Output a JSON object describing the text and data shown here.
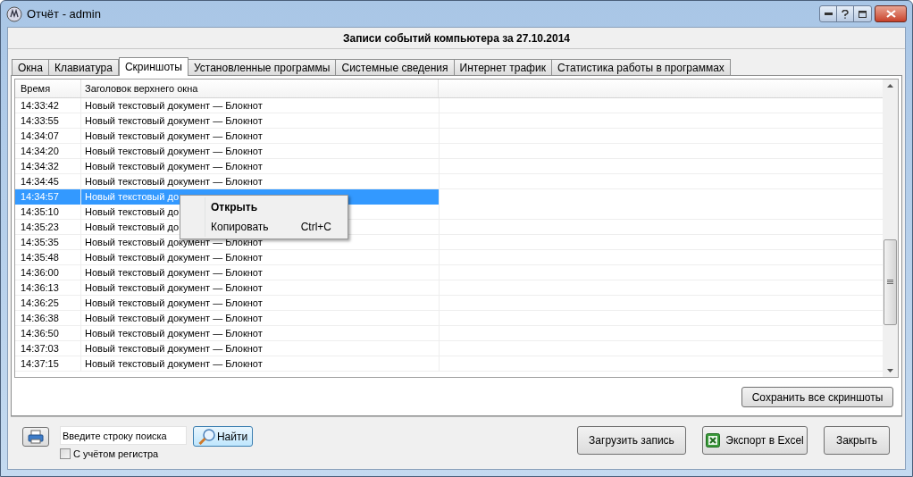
{
  "window": {
    "title": "Отчёт - admin"
  },
  "header": "Записи событий компьютера за 27.10.2014",
  "tabs": [
    {
      "label": "Окна",
      "selected": false
    },
    {
      "label": "Клавиатура",
      "selected": false
    },
    {
      "label": "Скриншоты",
      "selected": true
    },
    {
      "label": "Установленные программы",
      "selected": false
    },
    {
      "label": "Системные сведения",
      "selected": false
    },
    {
      "label": "Интернет трафик",
      "selected": false
    },
    {
      "label": "Статистика работы в программах",
      "selected": false
    }
  ],
  "table": {
    "columns": [
      "Время",
      "Заголовок верхнего окна"
    ],
    "rows": [
      {
        "time": "14:33:42",
        "title": "Новый текстовый документ — Блокнот",
        "selected": false
      },
      {
        "time": "14:33:55",
        "title": "Новый текстовый документ — Блокнот",
        "selected": false
      },
      {
        "time": "14:34:07",
        "title": "Новый текстовый документ — Блокнот",
        "selected": false
      },
      {
        "time": "14:34:20",
        "title": "Новый текстовый документ — Блокнот",
        "selected": false
      },
      {
        "time": "14:34:32",
        "title": "Новый текстовый документ — Блокнот",
        "selected": false
      },
      {
        "time": "14:34:45",
        "title": "Новый текстовый документ — Блокнот",
        "selected": false
      },
      {
        "time": "14:34:57",
        "title": "Новый текстовый до",
        "selected": true
      },
      {
        "time": "14:35:10",
        "title": "Новый текстовый до",
        "selected": false
      },
      {
        "time": "14:35:23",
        "title": "Новый текстовый до",
        "selected": false
      },
      {
        "time": "14:35:35",
        "title": "Новый текстовый документ — Блокнот",
        "selected": false
      },
      {
        "time": "14:35:48",
        "title": "Новый текстовый документ — Блокнот",
        "selected": false
      },
      {
        "time": "14:36:00",
        "title": "Новый текстовый документ — Блокнот",
        "selected": false
      },
      {
        "time": "14:36:13",
        "title": "Новый текстовый документ — Блокнот",
        "selected": false
      },
      {
        "time": "14:36:25",
        "title": "Новый текстовый документ — Блокнот",
        "selected": false
      },
      {
        "time": "14:36:38",
        "title": "Новый текстовый документ — Блокнот",
        "selected": false
      },
      {
        "time": "14:36:50",
        "title": "Новый текстовый документ — Блокнот",
        "selected": false
      },
      {
        "time": "14:37:03",
        "title": "Новый текстовый документ — Блокнот",
        "selected": false
      },
      {
        "time": "14:37:15",
        "title": "Новый текстовый документ — Блокнот",
        "selected": false
      }
    ]
  },
  "context_menu": {
    "items": [
      {
        "label": "Открыть",
        "bold": true
      },
      {
        "label": "Копировать",
        "shortcut": "Ctrl+C",
        "bold": false
      }
    ]
  },
  "save_all_button": "Сохранить все скриншоты",
  "search": {
    "placeholder": "Введите строку поиска",
    "button": "Найти",
    "case_checkbox": {
      "label": "С учётом регистра",
      "checked": false
    }
  },
  "buttons": {
    "load": "Загрузить запись",
    "export": "Экспорт в Excel",
    "close": "Закрыть"
  }
}
